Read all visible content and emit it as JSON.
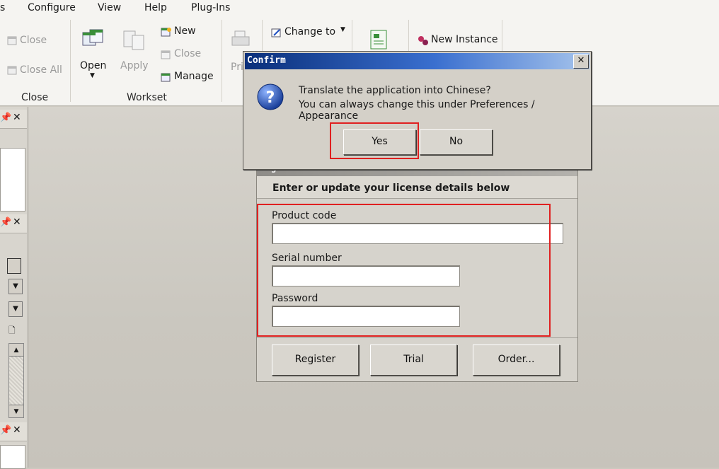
{
  "menu": [
    "s",
    "Configure",
    "View",
    "Help",
    "Plug-Ins"
  ],
  "ribbon": {
    "close_group": {
      "close": "Close",
      "close_all": "Close All",
      "label": "Close"
    },
    "workset_group": {
      "open": "Open",
      "apply": "Apply",
      "new": "New",
      "close": "Close",
      "manage": "Manage",
      "label": "Workset"
    },
    "print": "Pri",
    "change_to": "Change to",
    "new_instance": "New Instance"
  },
  "register": {
    "title": "Register",
    "header": "Enter or update your license details below",
    "product_code_label": "Product code",
    "product_code_value": "",
    "serial_label": "Serial number",
    "serial_value": "",
    "password_label": "Password",
    "password_value": "",
    "register_btn": "Register",
    "trial_btn": "Trial",
    "order_btn": "Order..."
  },
  "confirm": {
    "title": "Confirm",
    "line1": "Translate the application into Chinese?",
    "line2": "You can always change this under Preferences / Appearance",
    "yes": "Yes",
    "no": "No",
    "close_symbol": "✕"
  },
  "colors": {
    "highlight": "#e02020",
    "titlebar": "#0a2f7a"
  }
}
